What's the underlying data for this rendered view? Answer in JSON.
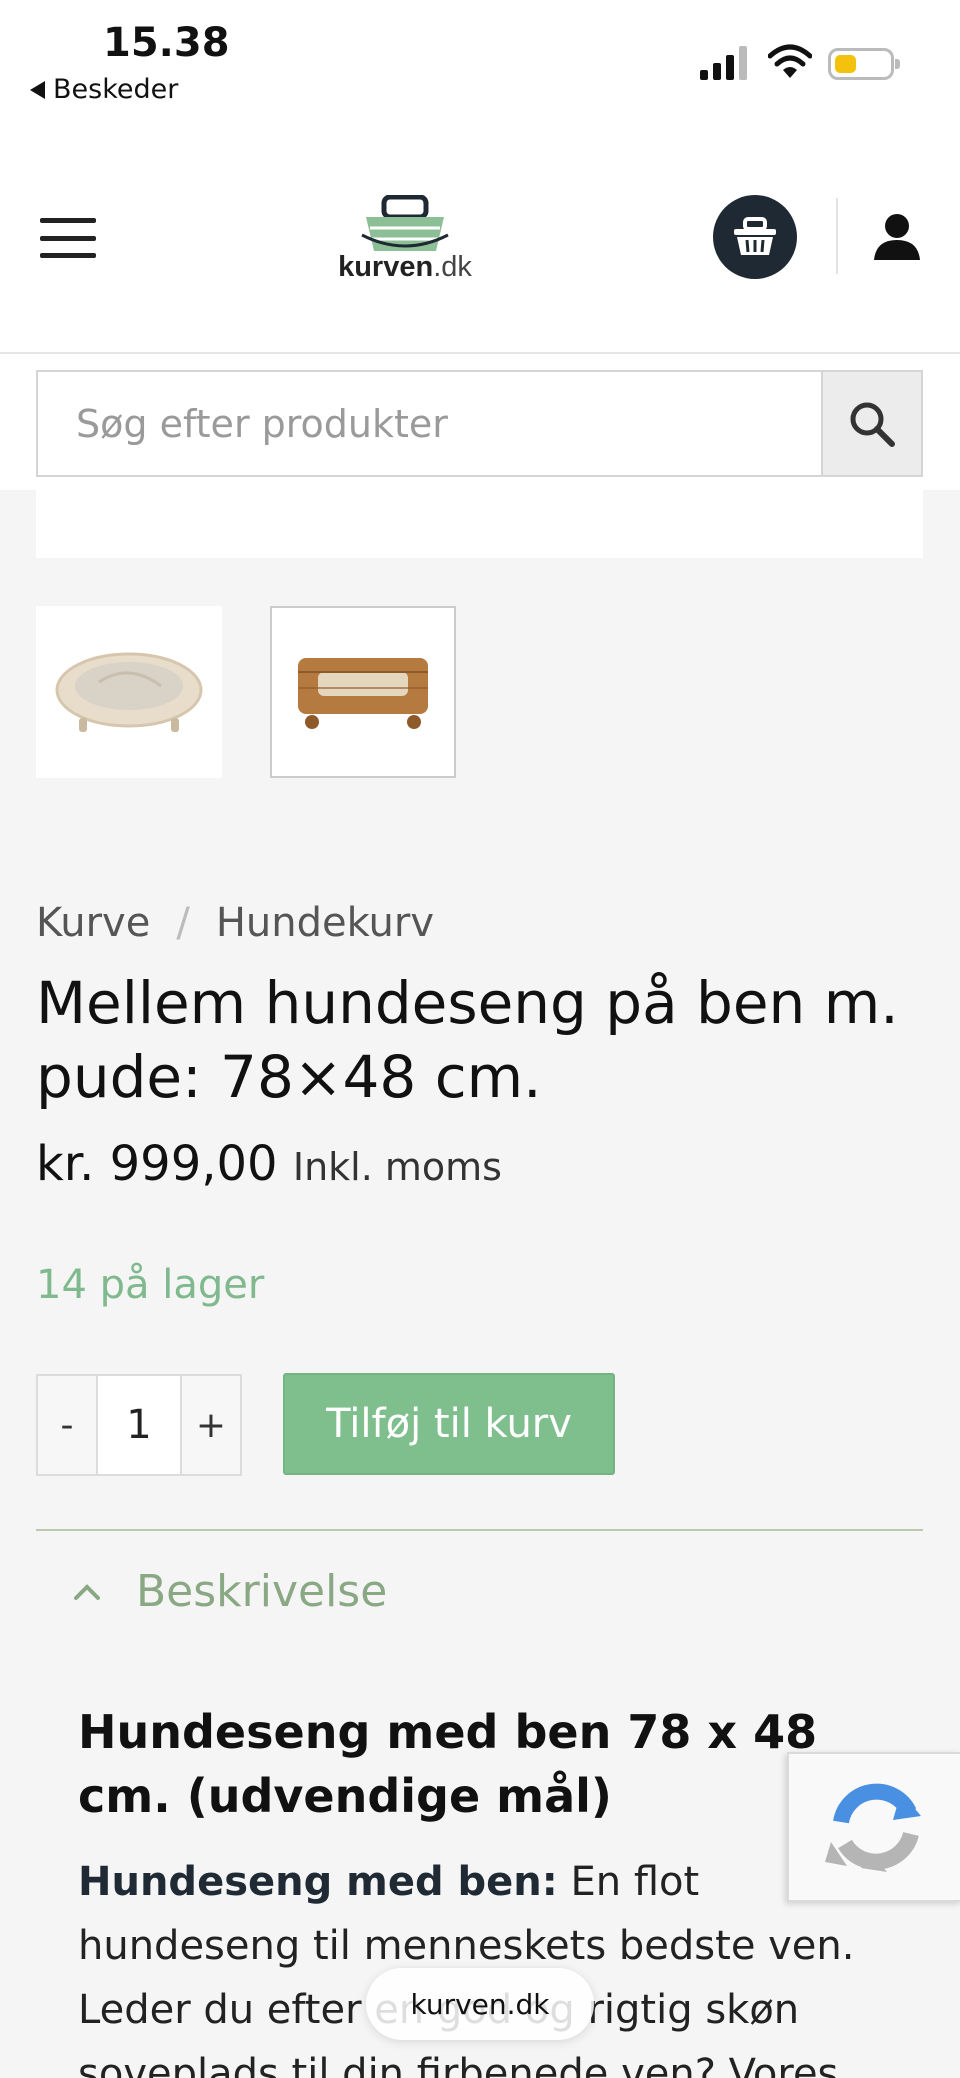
{
  "status_bar": {
    "time": "15.38",
    "back_label": "Beskeder"
  },
  "header": {
    "logo_bold": "kurven",
    "logo_suffix": ".dk"
  },
  "search": {
    "placeholder": "Søg efter produkter"
  },
  "breadcrumb": {
    "items": [
      "Kurve",
      "Hundekurv"
    ],
    "separator": "/"
  },
  "product": {
    "title": "Mellem hundeseng på ben m. pude: 78×48 cm.",
    "price": "kr. 999,00",
    "tax_note": "Inkl. moms",
    "stock": "14 på lager",
    "quantity": "1",
    "qty_minus": "-",
    "qty_plus": "+",
    "add_to_cart": "Tilføj til kurv"
  },
  "tabs": {
    "description_label": "Beskrivelse"
  },
  "description": {
    "heading": "Hundeseng med ben 78 x 48 cm. (udvendige mål)",
    "lead_bold": "Hundeseng med ben:",
    "lead_text": " En flot hundeseng til menneskets bedste ven. Leder du efter en god og rigtig skøn soveplads til din firbenede ven? Vores smukke"
  },
  "browser": {
    "url": "kurven.dk"
  },
  "colors": {
    "accent_green": "#7fbf8d",
    "stock_green": "#7fb98d",
    "cart_dark": "#1f2933"
  }
}
